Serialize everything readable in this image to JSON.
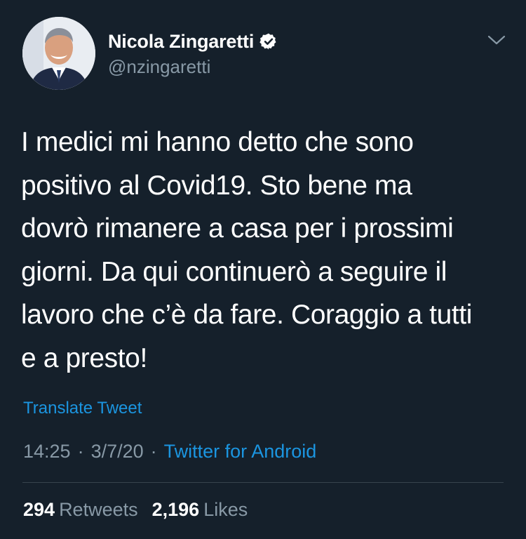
{
  "author": {
    "display_name": "Nicola Zingaretti",
    "handle": "@nzingaretti",
    "verified": true,
    "avatar_icon": "profile-photo"
  },
  "tweet": {
    "text": "I medici mi hanno detto che sono\npositivo al Covid19. Sto bene ma\ndovrò rimanere a casa per i prossimi\ngiorni. Da qui continuerò a seguire il\nlavoro che c’è da fare. Coraggio a tutti\ne a presto!",
    "translate_label": "Translate Tweet",
    "time": "14:25",
    "separator": "·",
    "date": "3/7/20",
    "source": "Twitter for Android"
  },
  "stats": {
    "retweets_count": "294",
    "retweets_label": "Retweets",
    "likes_count": "2,196",
    "likes_label": "Likes"
  },
  "colors": {
    "background": "#15202b",
    "text": "#ffffff",
    "secondary_text": "#8899a6",
    "link": "#1b95e0",
    "divider": "#38444d"
  }
}
